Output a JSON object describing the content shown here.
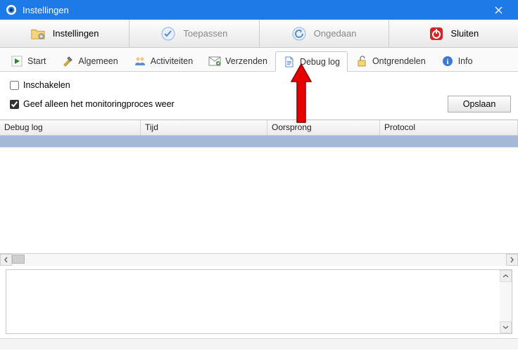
{
  "window": {
    "title": "Instellingen"
  },
  "toolbar1": {
    "settings": "Instellingen",
    "apply": "Toepassen",
    "undo": "Ongedaan",
    "close": "Sluiten"
  },
  "tabs": {
    "start": "Start",
    "general": "Algemeen",
    "activities": "Activiteiten",
    "send": "Verzenden",
    "debuglog": "Debug log",
    "unlock": "Ontgrendelen",
    "info": "Info"
  },
  "pane": {
    "enable_label": "Inschakelen",
    "monitor_label": "Geef alleen het monitoringproces weer",
    "save_btn": "Opslaan"
  },
  "grid": {
    "columns": {
      "c1": "Debug log",
      "c2": "Tijd",
      "c3": "Oorsprong",
      "c4": "Protocol"
    }
  }
}
